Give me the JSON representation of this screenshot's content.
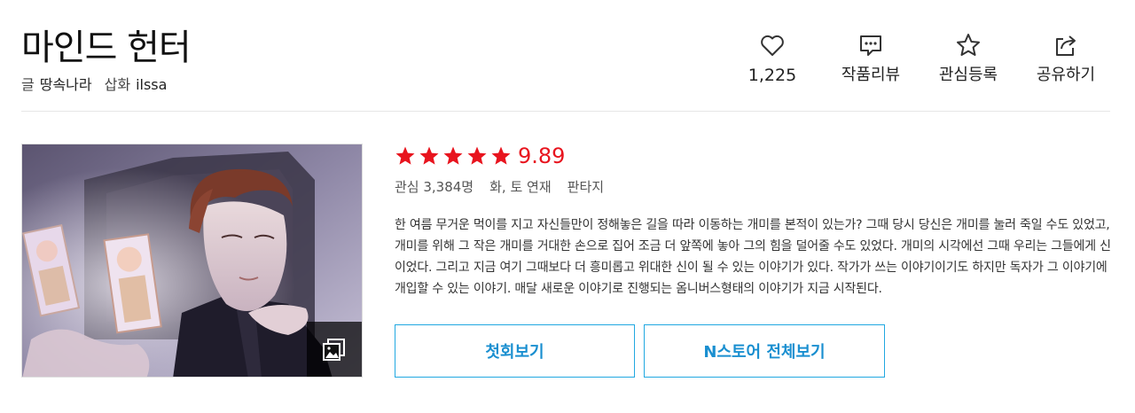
{
  "work": {
    "title": "마인드 헌터",
    "writer_role": "글",
    "writer": "땅속나라",
    "illustrator_role": "삽화",
    "illustrator": "ilssa"
  },
  "actions": {
    "like_count": "1,225",
    "review_label": "작품리뷰",
    "subscribe_label": "관심등록",
    "share_label": "공유하기"
  },
  "rating": {
    "stars": 5,
    "score": "9.89",
    "star_color": "#e8141e"
  },
  "meta": {
    "interest": "관심 3,384명",
    "schedule": "화, 토 연재",
    "genre": "판타지"
  },
  "description": "한 여름 무거운 먹이를 지고 자신들만이 정해놓은 길을 따라 이동하는 개미를 본적이 있는가? 그때 당시 당신은 개미를 눌러 죽일 수도 있었고, 개미를 위해 그 작은 개미를 거대한 손으로 집어 조금 더 앞쪽에 놓아 그의 힘을 덜어줄 수도 있었다. 개미의 시각에선 그때 우리는 그들에게 신이었다. 그리고 지금 여기 그때보다 더 흥미롭고 위대한 신이 될 수 있는 이야기가 있다. 작가가 쓰는 이야기이기도 하지만 독자가 그 이야기에 개입할 수 있는 이야기. 매달 새로운 이야기로 진행되는 옴니버스형태의 이야기가 지금 시작된다.",
  "buttons": {
    "first_episode": "첫회보기",
    "nstore": "N스토어 전체보기"
  },
  "colors": {
    "accent": "#21a8e1",
    "rating": "#e8141e"
  }
}
